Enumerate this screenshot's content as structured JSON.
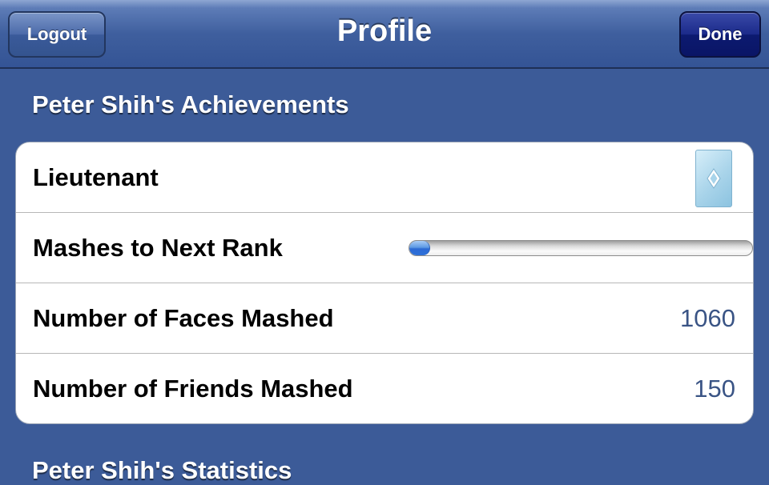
{
  "navbar": {
    "title": "Profile",
    "left_button": "Logout",
    "right_button": "Done"
  },
  "achievements": {
    "header": "Peter Shih's Achievements",
    "rows": [
      {
        "label": "Lieutenant",
        "icon": "rank-diamond-card-icon"
      },
      {
        "label": "Mashes to Next Rank",
        "progress": 0.06
      },
      {
        "label": "Number of Faces Mashed",
        "value": "1060"
      },
      {
        "label": "Number of Friends Mashed",
        "value": "150"
      }
    ]
  },
  "statistics": {
    "header": "Peter Shih's Statistics"
  },
  "colors": {
    "background": "#3c5b98",
    "value_text": "#3a5485",
    "done_button": "#0c1a70",
    "progress_fill": "#2e70d8"
  }
}
